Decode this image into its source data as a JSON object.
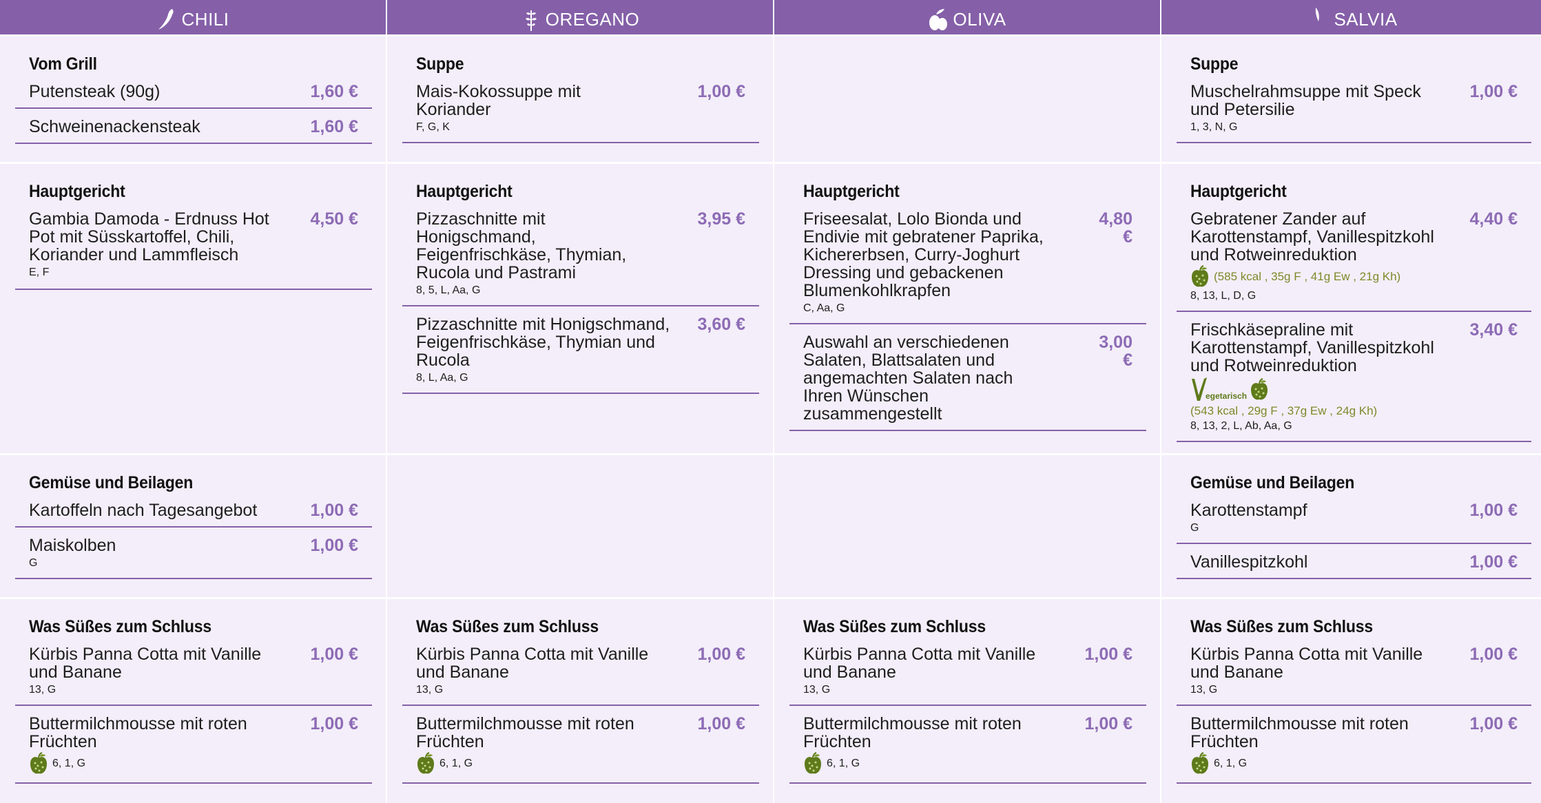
{
  "columns": [
    {
      "name": "CHILI",
      "icon": "chili-icon"
    },
    {
      "name": "OREGANO",
      "icon": "oregano-icon"
    },
    {
      "name": "OLIVA",
      "icon": "olive-icon"
    },
    {
      "name": "SALVIA",
      "icon": "sage-leaf-icon"
    }
  ],
  "colors": {
    "header_bg": "#8560a8",
    "price": "#8d6bb5",
    "cell_bg": "#f3eef9",
    "nutrition": "#7c8a2a"
  },
  "chili": {
    "grill": {
      "title": "Vom Grill",
      "items": [
        {
          "name": "Putensteak (90g)",
          "price": "1,60 €"
        },
        {
          "name": "Schweinenackensteak",
          "price": "1,60 €"
        }
      ]
    },
    "main": {
      "title": "Hauptgericht",
      "items": [
        {
          "name": "Gambia Damoda - Erdnuss Hot Pot mit Süsskartoffel, Chili, Koriander und Lammfleisch",
          "price": "4,50 €",
          "allergens": "E, F"
        }
      ]
    },
    "sides": {
      "title": "Gemüse und Beilagen",
      "items": [
        {
          "name": "Kartoffeln nach Tagesangebot",
          "price": "1,00 €"
        },
        {
          "name": "Maiskolben",
          "price": "1,00 €",
          "allergens": "G"
        }
      ]
    },
    "dessert": {
      "title": "Was Süßes zum Schluss",
      "items": [
        {
          "name": "Kürbis Panna Cotta mit Vanille und Banane",
          "price": "1,00 €",
          "allergens": "13, G"
        },
        {
          "name": "Buttermilchmousse mit roten Früchten",
          "price": "1,00 €",
          "allergens": "6, 1, G"
        }
      ]
    }
  },
  "oregano": {
    "soup": {
      "title": "Suppe",
      "items": [
        {
          "name": "Mais-Kokossuppe mit Koriander",
          "price": "1,00 €",
          "allergens": "F, G, K"
        }
      ]
    },
    "main": {
      "title": "Hauptgericht",
      "items": [
        {
          "name": "Pizzaschnitte mit Honigschmand, Feigenfrischkäse, Thymian, Rucola und Pastrami",
          "price": "3,95 €",
          "allergens": "8, 5, L, Aa, G"
        },
        {
          "name": "Pizzaschnitte mit Honigschmand, Feigenfrischkäse, Thymian und Rucola",
          "price": "3,60 €",
          "allergens": "8, L, Aa, G"
        }
      ]
    },
    "dessert": {
      "title": "Was Süßes zum Schluss",
      "items": [
        {
          "name": "Kürbis Panna Cotta mit Vanille und Banane",
          "price": "1,00 €",
          "allergens": "13, G"
        },
        {
          "name": "Buttermilchmousse mit roten Früchten",
          "price": "1,00 €",
          "allergens": "6, 1, G"
        }
      ]
    }
  },
  "oliva": {
    "main": {
      "title": "Hauptgericht",
      "items": [
        {
          "name": "Friseesalat, Lolo Bionda und Endivie mit gebratener Paprika, Kichererbsen, Curry-Joghurt Dressing und gebackenen Blumenkohlkrapfen",
          "price": "4,80 €",
          "allergens": "C, Aa, G"
        },
        {
          "name": "Auswahl an verschiedenen Salaten, Blattsalaten und angemachten Salaten nach Ihren Wünschen zusammengestellt",
          "price": "3,00 €"
        }
      ]
    },
    "dessert": {
      "title": "Was Süßes zum Schluss",
      "items": [
        {
          "name": "Kürbis Panna Cotta mit Vanille und Banane",
          "price": "1,00 €",
          "allergens": "13, G"
        },
        {
          "name": "Buttermilchmousse mit roten Früchten",
          "price": "1,00 €",
          "allergens": "6, 1, G"
        }
      ]
    }
  },
  "salvia": {
    "soup": {
      "title": "Suppe",
      "items": [
        {
          "name": "Muschelrahmsuppe mit Speck und Petersilie",
          "price": "1,00 €",
          "allergens": "1, 3, N, G"
        }
      ]
    },
    "main": {
      "title": "Hauptgericht",
      "items": [
        {
          "name": "Gebratener Zander auf Karottenstampf, Vanillespitzkohl und Rotweinreduktion",
          "price": "4,40 €",
          "nutrition": "(585 kcal , 35g F , 41g Ew , 21g Kh)",
          "allergens": "8, 13, L, D, G"
        },
        {
          "name": "Frischkäsepraline mit Karottenstampf, Vanillespitzkohl und Rotweinreduktion",
          "price": "3,40 €",
          "veg_label": "egetarisch",
          "nutrition": "(543 kcal , 29g F , 37g Ew , 24g Kh)",
          "allergens": "8, 13, 2, L, Ab, Aa, G"
        }
      ]
    },
    "sides": {
      "title": "Gemüse und Beilagen",
      "items": [
        {
          "name": "Karottenstampf",
          "price": "1,00 €",
          "allergens": "G"
        },
        {
          "name": "Vanillespitzkohl",
          "price": "1,00 €"
        }
      ]
    },
    "dessert": {
      "title": "Was Süßes zum Schluss",
      "items": [
        {
          "name": "Kürbis Panna Cotta mit Vanille und Banane",
          "price": "1,00 €",
          "allergens": "13, G"
        },
        {
          "name": "Buttermilchmousse mit roten Früchten",
          "price": "1,00 €",
          "allergens": "6, 1, G"
        }
      ]
    }
  }
}
